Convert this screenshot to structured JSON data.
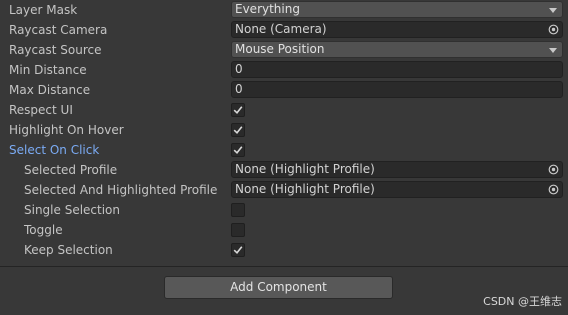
{
  "properties": [
    {
      "label": "Layer Mask",
      "control": "dropdown",
      "value": "Everything"
    },
    {
      "label": "Raycast Camera",
      "control": "object",
      "value": "None (Camera)"
    },
    {
      "label": "Raycast Source",
      "control": "dropdown",
      "value": "Mouse Position"
    },
    {
      "label": "Min Distance",
      "control": "number",
      "value": "0"
    },
    {
      "label": "Max Distance",
      "control": "number",
      "value": "0"
    },
    {
      "label": "Respect UI",
      "control": "toggle",
      "checked": true
    },
    {
      "label": "Highlight On Hover",
      "control": "toggle",
      "checked": true
    },
    {
      "label": "Select On Click",
      "control": "toggle",
      "checked": true,
      "highlighted": true
    },
    {
      "label": "Selected Profile",
      "control": "object",
      "value": "None (Highlight Profile)",
      "indent": true
    },
    {
      "label": "Selected And Highlighted Profile",
      "control": "object",
      "value": "None (Highlight Profile)",
      "indent": true
    },
    {
      "label": "Single Selection",
      "control": "toggle",
      "checked": false,
      "indent": true
    },
    {
      "label": "Toggle",
      "control": "toggle",
      "checked": false,
      "indent": true
    },
    {
      "label": "Keep Selection",
      "control": "toggle",
      "checked": true,
      "indent": true
    }
  ],
  "add_component_label": "Add Component",
  "watermark": "CSDN @王维志",
  "colors": {
    "background": "#383838",
    "field": "#2a2a2a",
    "highlight_label": "#7babf4",
    "button": "#585858"
  }
}
